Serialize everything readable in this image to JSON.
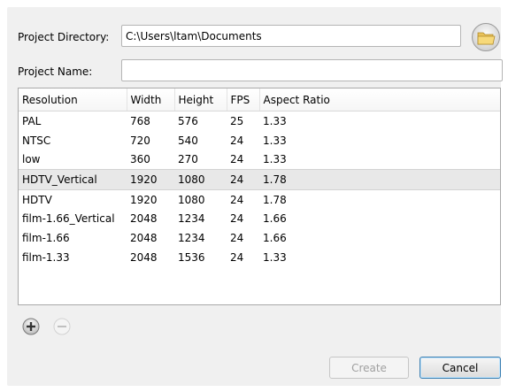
{
  "form": {
    "project_directory_label": "Project Directory:",
    "project_directory_value": "C:\\Users\\ltam\\Documents",
    "project_name_label": "Project Name:",
    "project_name_value": ""
  },
  "icons": {
    "browse": "folder-icon",
    "add": "plus-circle-icon",
    "remove": "minus-circle-icon"
  },
  "table": {
    "columns": [
      "Resolution",
      "Width",
      "Height",
      "FPS",
      "Aspect Ratio"
    ],
    "rows": [
      [
        "PAL",
        "768",
        "576",
        "25",
        "1.33"
      ],
      [
        "NTSC",
        "720",
        "540",
        "24",
        "1.33"
      ],
      [
        "low",
        "360",
        "270",
        "24",
        "1.33"
      ],
      [
        "HDTV_Vertical",
        "1920",
        "1080",
        "24",
        "1.78"
      ],
      [
        "HDTV",
        "1920",
        "1080",
        "24",
        "1.78"
      ],
      [
        "film-1.66_Vertical",
        "2048",
        "1234",
        "24",
        "1.66"
      ],
      [
        "film-1.66",
        "2048",
        "1234",
        "24",
        "1.66"
      ],
      [
        "film-1.33",
        "2048",
        "1536",
        "24",
        "1.33"
      ]
    ],
    "selected_row": "HDTV_Vertical"
  },
  "buttons": {
    "create": "Create",
    "create_enabled": false,
    "cancel": "Cancel"
  }
}
